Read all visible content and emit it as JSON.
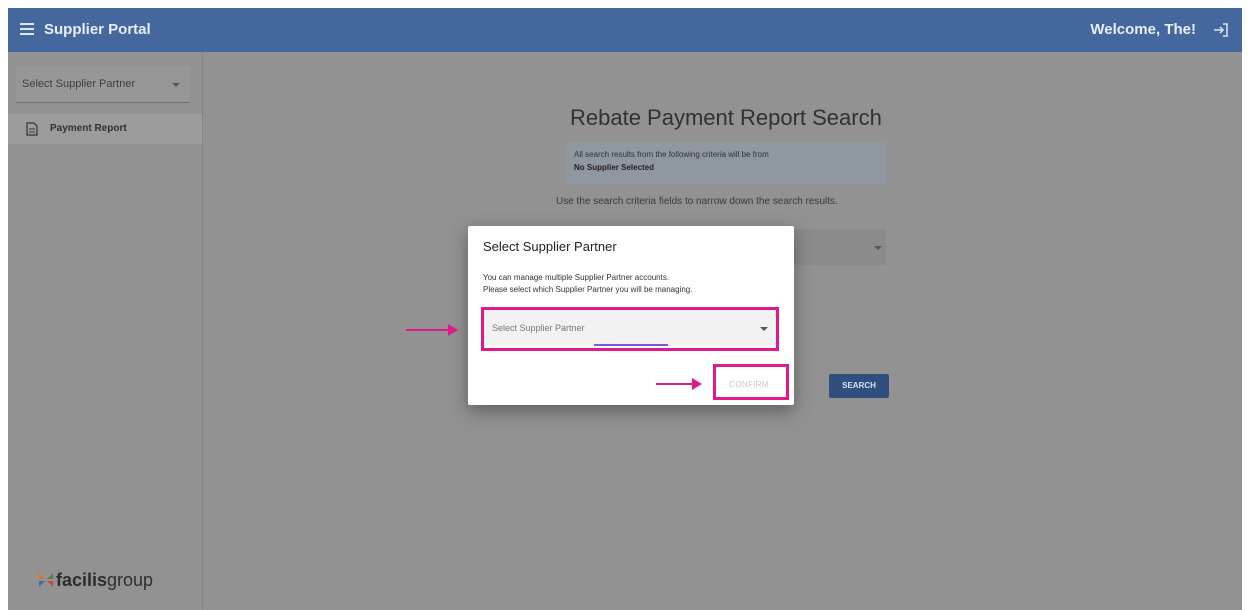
{
  "header": {
    "app_title": "Supplier Portal",
    "welcome": "Welcome, The!"
  },
  "sidebar": {
    "select_label": "Select Supplier Partner",
    "items": [
      {
        "label": "Payment Report",
        "icon": "document-icon"
      }
    ],
    "logo": {
      "bold": "facilis",
      "regular": "group"
    }
  },
  "main": {
    "title": "Rebate Payment Report Search",
    "notice_line1": "All search results from the following criteria will be from",
    "notice_line2": "No Supplier Selected",
    "hint": "Use the search criteria fields to narrow down the search results.",
    "search_label": "SEARCH"
  },
  "dialog": {
    "title": "Select Supplier Partner",
    "text_line1": "You can manage multiple Supplier Partner accounts.",
    "text_line2": "Please select which Supplier Partner you will be managing.",
    "select_placeholder": "Select Supplier Partner",
    "confirm_label": "CONFIRM"
  },
  "colors": {
    "header": "#44689e",
    "highlight": "#e01a8c",
    "button": "#304f7f",
    "underline": "#7a5bd8"
  }
}
